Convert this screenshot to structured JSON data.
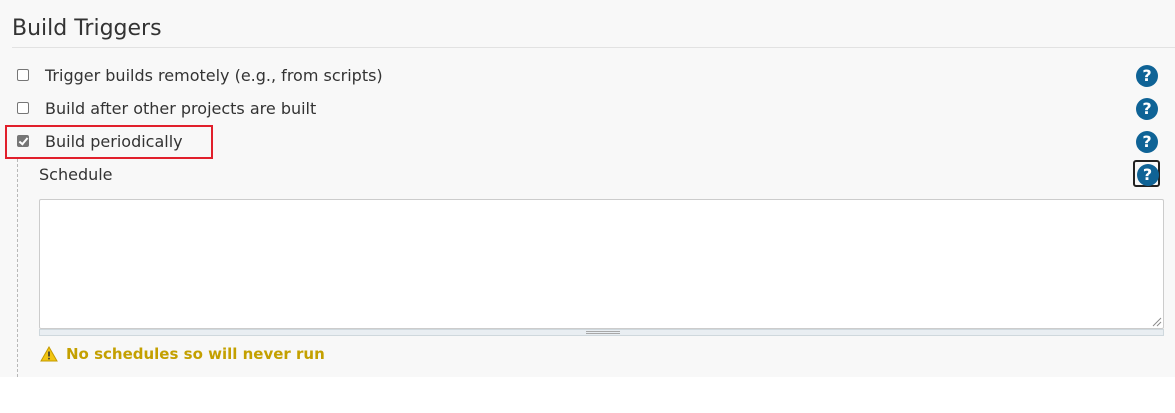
{
  "section": {
    "title": "Build Triggers"
  },
  "triggers": [
    {
      "label": "Trigger builds remotely (e.g., from scripts)",
      "checked": false
    },
    {
      "label": "Build after other projects are built",
      "checked": false
    },
    {
      "label": "Build periodically",
      "checked": true
    }
  ],
  "schedule": {
    "label": "Schedule",
    "value": "",
    "warning": "No schedules so will never run"
  },
  "help_symbol": "?",
  "icons": {
    "help": "help-icon",
    "warning": "warning-triangle-icon"
  },
  "colors": {
    "help_icon": "#0f6396",
    "highlight": "#e11f2b",
    "warning_text": "#c4a000",
    "warning_icon": "#f2c511"
  }
}
